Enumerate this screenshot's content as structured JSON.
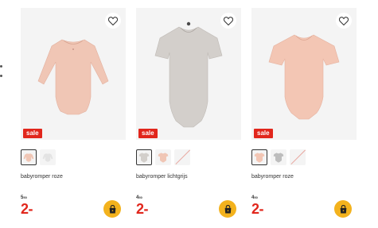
{
  "products": [
    {
      "name": "babyromper roze",
      "sale_badge": "sale",
      "old_price_main": "5",
      "old_price_cents": "50",
      "price": "2-",
      "garment_type": "long-sleeve bodysuit",
      "garment_color": "#f0c6b5",
      "swatches": [
        {
          "color": "#f0c6b5",
          "active": true,
          "unavailable": false
        },
        {
          "color": "#e8e8e8",
          "active": false,
          "unavailable": false
        }
      ]
    },
    {
      "name": "babyromper lichtgrijs",
      "sale_badge": "sale",
      "old_price_main": "4",
      "old_price_cents": "50",
      "price": "2-",
      "garment_type": "short-sleeve bodysuit",
      "garment_color": "#d3cfcb",
      "swatches": [
        {
          "color": "#d3cfcb",
          "active": true,
          "unavailable": false
        },
        {
          "color": "#f0c6b5",
          "active": false,
          "unavailable": false
        },
        {
          "color": "#f4f4f4",
          "active": false,
          "unavailable": true
        }
      ]
    },
    {
      "name": "babyromper roze",
      "sale_badge": "sale",
      "old_price_main": "4",
      "old_price_cents": "50",
      "price": "2-",
      "garment_type": "short-sleeve bodysuit",
      "garment_color": "#f3c6b4",
      "swatches": [
        {
          "color": "#f3c6b4",
          "active": true,
          "unavailable": false
        },
        {
          "color": "#bdbdbd",
          "active": false,
          "unavailable": false
        },
        {
          "color": "#f4f4f4",
          "active": false,
          "unavailable": true
        }
      ]
    }
  ],
  "icons": {
    "favorite": "heart-outline-icon",
    "cart": "shopping-bag-icon"
  },
  "colors": {
    "sale_red": "#e1261c",
    "cart_yellow": "#f3b21d",
    "tile_bg": "#f4f4f4"
  }
}
